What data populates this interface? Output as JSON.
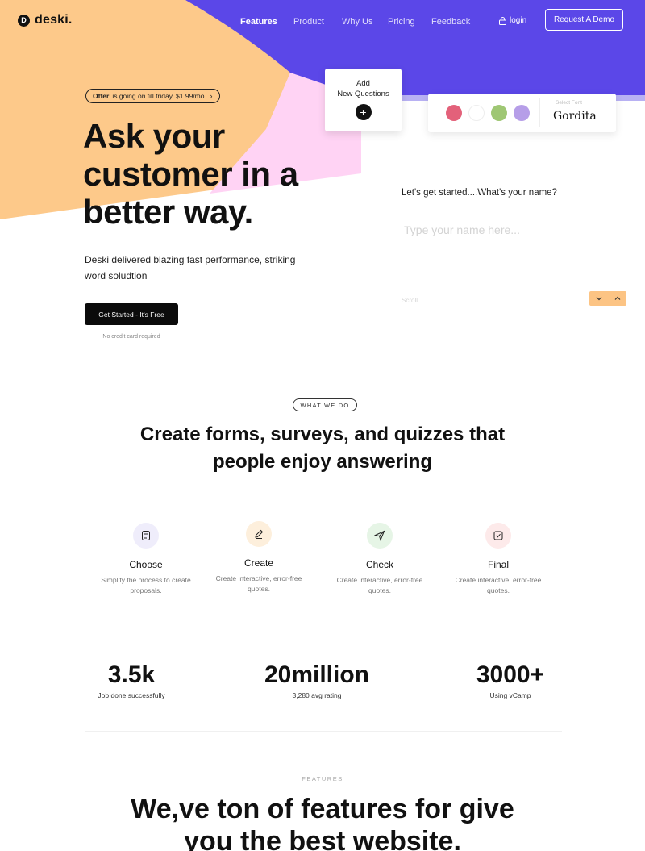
{
  "brand": {
    "logo_letter": "D",
    "name": "deski."
  },
  "colors": {
    "purple": "#5b47e8",
    "peach": "#fdc98a",
    "pink": "#ffd3f4",
    "dark": "#0b0b0b"
  },
  "nav": {
    "items": [
      "Features",
      "Product",
      "Why Us",
      "Pricing",
      "Feedback"
    ],
    "active": "Features",
    "login": "login",
    "demo": "Request A Demo"
  },
  "hero": {
    "offer_bold": "Offer",
    "offer_rest": "is going on till friday, $1.99/mo",
    "title": "Ask your customer in a better way.",
    "description": "Deski delivered blazing fast performance, striking word soludtion",
    "cta": "Get Started - It's Free",
    "cta_note": "No credit card required"
  },
  "preview": {
    "add_line1": "Add",
    "add_line2": "New Questions",
    "swatches": [
      "#e3617a",
      "#ffffff",
      "#9fc774",
      "#b69ee8"
    ],
    "font_label": "Select Font",
    "font_name": "Gordita",
    "question": "Let's get started....What's your name?",
    "input_placeholder": "Type your name here...",
    "scroll_label": "Scroll"
  },
  "what_we_do": {
    "tag": "WHAT WE DO",
    "title_line1": "Create forms, surveys, and quizzes that",
    "title_line2": "people enjoy answering",
    "items": [
      {
        "name": "Choose",
        "desc": "Simplify the process to create proposals.",
        "icon": "list-icon",
        "bg": "#efedfb"
      },
      {
        "name": "Create",
        "desc": "Create interactive, error-free quotes.",
        "icon": "pen-icon",
        "bg": "#fdefdc"
      },
      {
        "name": "Check",
        "desc": "Create interactive, error-free quotes.",
        "icon": "send-icon",
        "bg": "#e6f5e6"
      },
      {
        "name": "Final",
        "desc": "Create interactive, error-free quotes.",
        "icon": "check-icon",
        "bg": "#fdeaea"
      }
    ]
  },
  "stats": [
    {
      "value": "3.5k",
      "label": "Job done successfully"
    },
    {
      "value": "20million",
      "label": "3,280 avg rating"
    },
    {
      "value": "3000+",
      "label": "Using vCamp"
    }
  ],
  "features_section": {
    "tag": "FEATURES",
    "title_line1": "We,ve ton of features for give",
    "title_line2": "you the best website."
  }
}
